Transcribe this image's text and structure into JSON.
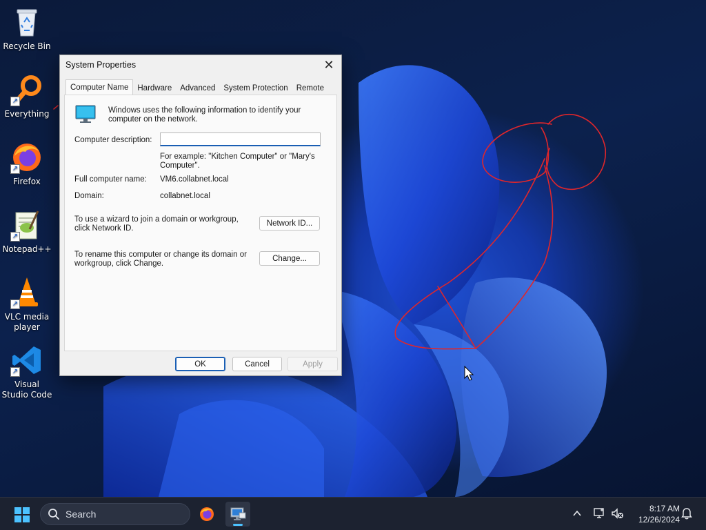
{
  "desktop": {
    "icons": [
      {
        "label": "Recycle Bin",
        "icon": "recycle-bin-icon"
      },
      {
        "label": "Everything",
        "icon": "everything-search-icon"
      },
      {
        "label": "Firefox",
        "icon": "firefox-icon"
      },
      {
        "label": "Notepad++",
        "icon": "notepad-plus-plus-icon"
      },
      {
        "label": "VLC media player",
        "icon": "vlc-icon"
      },
      {
        "label": "Visual Studio Code",
        "icon": "vscode-icon"
      }
    ],
    "annotation_color": "#e0262b"
  },
  "dialog": {
    "title": "System Properties",
    "tabs": [
      "Computer Name",
      "Hardware",
      "Advanced",
      "System Protection",
      "Remote"
    ],
    "active_tab": "Computer Name",
    "intro": "Windows uses the following information to identify your computer on the network.",
    "description_label": "Computer description:",
    "description_value": "",
    "example": "For example: \"Kitchen Computer\" or \"Mary's Computer\".",
    "full_name_label": "Full computer name:",
    "full_name_value": "VM6.collabnet.local",
    "domain_label": "Domain:",
    "domain_value": "collabnet.local",
    "network_id_text": "To use a wizard to join a domain or workgroup, click Network ID.",
    "network_id_button": "Network ID...",
    "change_text": "To rename this computer or change its domain or workgroup, click Change.",
    "change_button": "Change...",
    "ok_button": "OK",
    "cancel_button": "Cancel",
    "apply_button": "Apply"
  },
  "taskbar": {
    "search_placeholder": "Search",
    "pinned": [
      "firefox-icon",
      "system-properties-icon"
    ],
    "time": "8:17 AM",
    "date": "12/26/2024"
  },
  "colors": {
    "accent": "#1a5fb4",
    "taskbar_bg": "#1c2230",
    "active_indicator": "#4cc2ff"
  }
}
